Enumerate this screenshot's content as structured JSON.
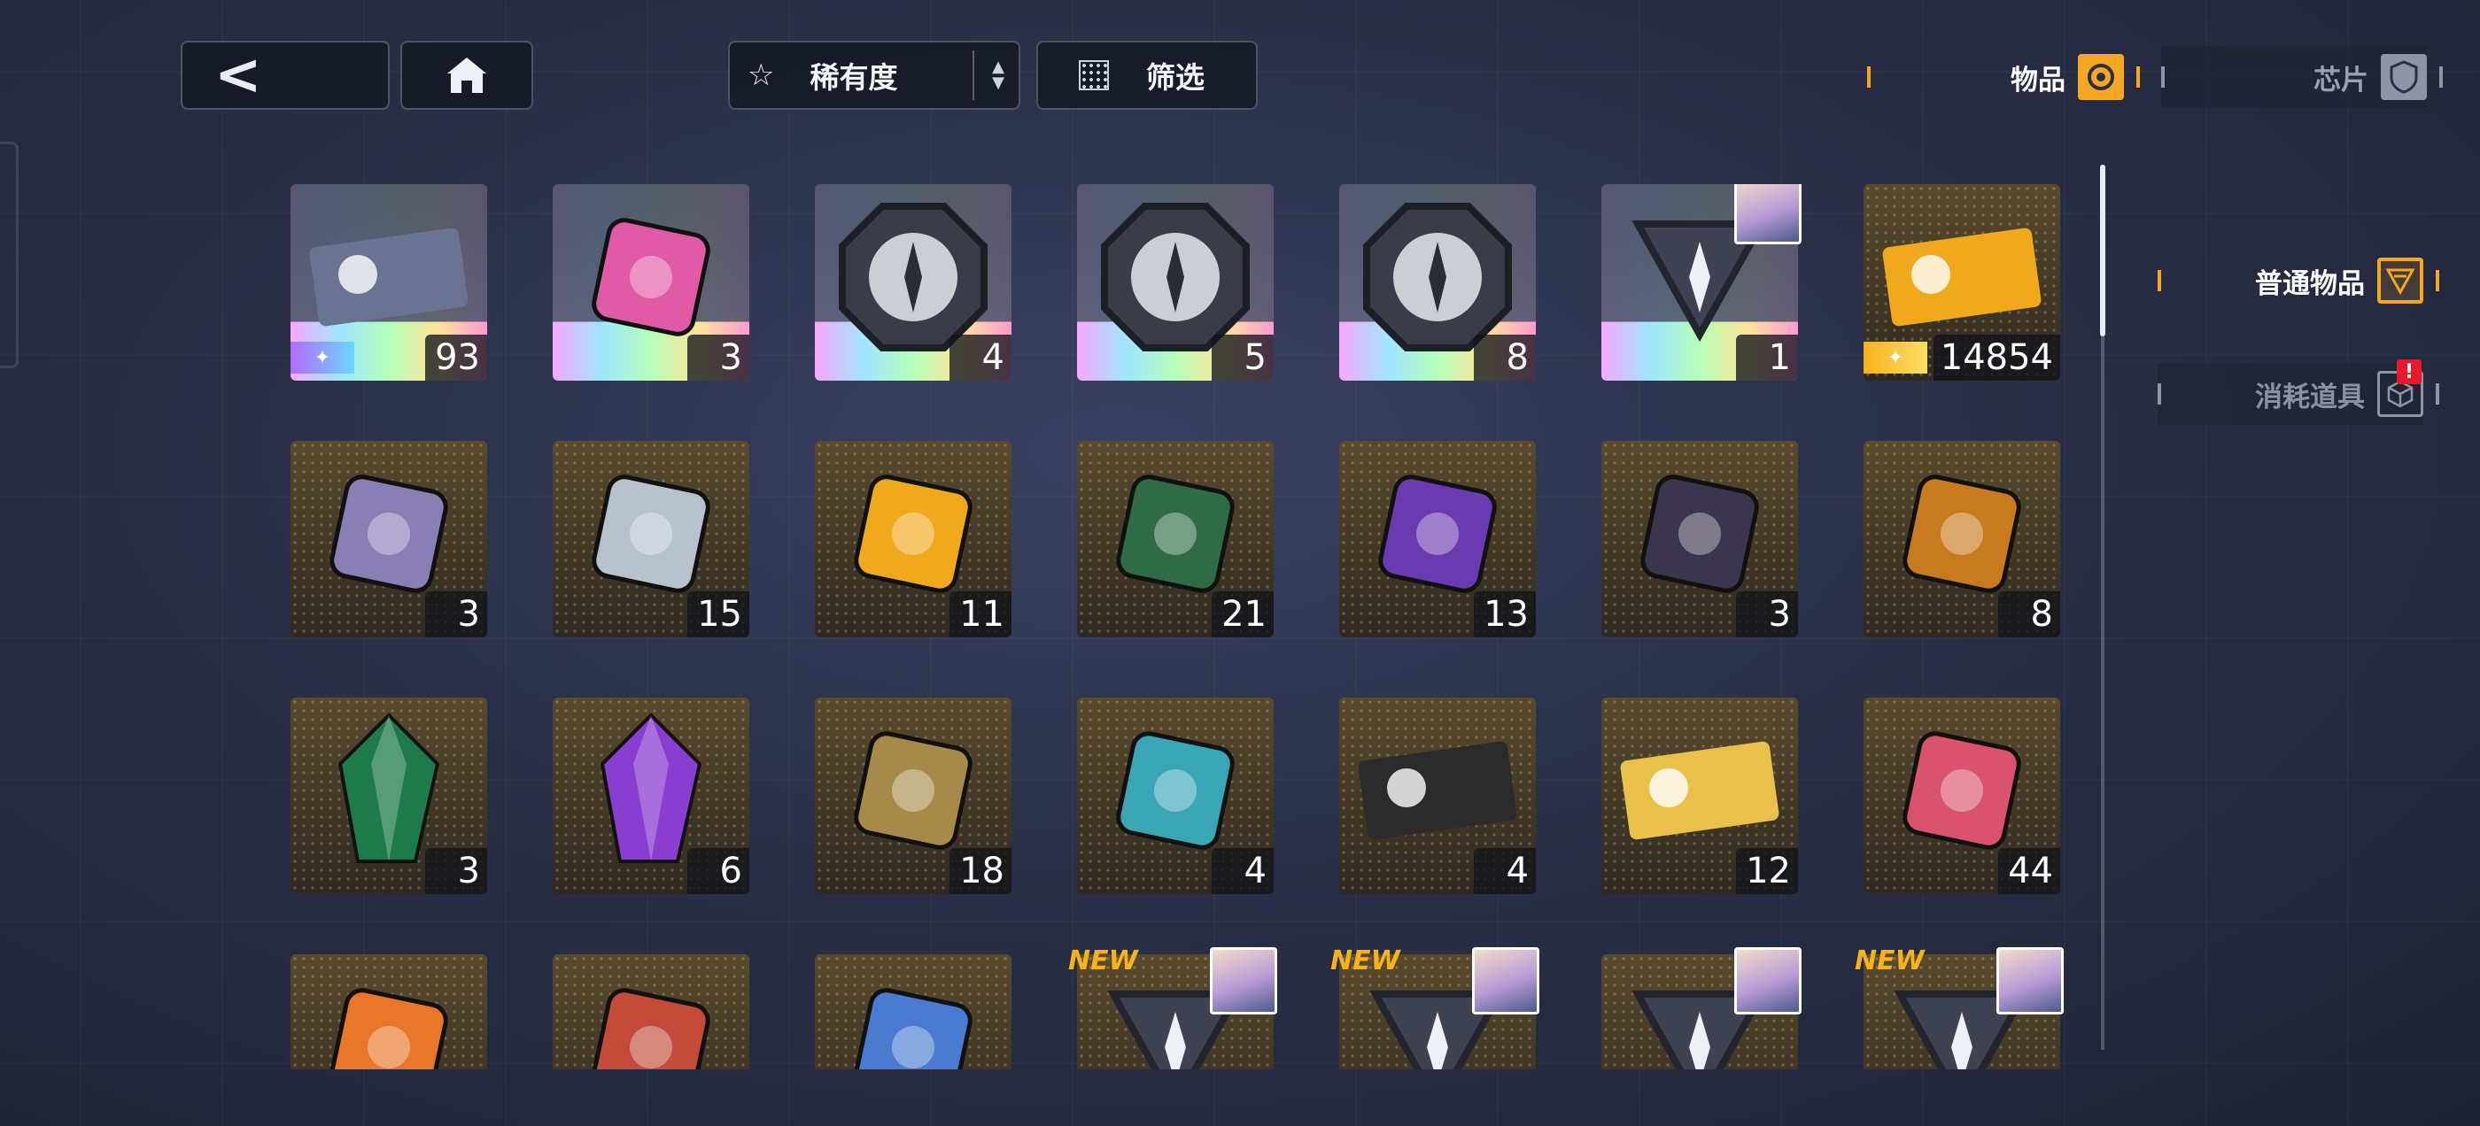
{
  "nav": {
    "back_glyph": "<"
  },
  "toolbar": {
    "sort_star": "☆",
    "sort_label": "稀有度",
    "sort_up": "▲",
    "sort_down": "▼",
    "filter_label": "筛选"
  },
  "tabs": [
    {
      "label": "物品",
      "icon": "item-icon",
      "active": true
    },
    {
      "label": "芯片",
      "icon": "chip-shield-icon",
      "active": false
    }
  ],
  "subtabs": [
    {
      "label": "普通物品",
      "icon": "box-icon",
      "active": true
    },
    {
      "label": "消耗道具",
      "icon": "cube-icon",
      "active": false,
      "badge": "!"
    }
  ],
  "colors": {
    "accent": "#f5a623",
    "badge": "#e8192c",
    "new_tag": "#f5b21b"
  },
  "items": [
    {
      "name": "nikke-ticket-card",
      "count": "93",
      "frame": "rainbow",
      "rarity_icon": "✦"
    },
    {
      "name": "heart-gift-box",
      "count": "3",
      "frame": "rainbow"
    },
    {
      "name": "octagon-emblem-wings",
      "count": "4",
      "frame": "rainbow"
    },
    {
      "name": "octagon-emblem-sword",
      "count": "5",
      "frame": "rainbow"
    },
    {
      "name": "octagon-emblem-gear",
      "count": "8",
      "frame": "rainbow"
    },
    {
      "name": "triangle-core-portrait",
      "count": "1",
      "frame": "rainbow",
      "portrait": true
    },
    {
      "name": "gold-nikke-ticket",
      "count": "14854",
      "frame": "gold",
      "rarity_icon": "✦"
    },
    {
      "name": "spiral-module-box",
      "count": "3",
      "frame": "gold"
    },
    {
      "name": "lock-triangle-chip",
      "count": "15",
      "frame": "gold"
    },
    {
      "name": "gold-cube-cluster",
      "count": "11",
      "frame": "gold"
    },
    {
      "name": "green-supply-bag",
      "count": "21",
      "frame": "gold"
    },
    {
      "name": "purple-orb-device",
      "count": "13",
      "frame": "gold"
    },
    {
      "name": "lantern-core",
      "count": "3",
      "frame": "gold"
    },
    {
      "name": "gold-brick-pile",
      "count": "8",
      "frame": "gold"
    },
    {
      "name": "green-crystal",
      "count": "3",
      "frame": "gold"
    },
    {
      "name": "purple-crystal",
      "count": "6",
      "frame": "gold"
    },
    {
      "name": "battery-capsule",
      "count": "18",
      "frame": "gold"
    },
    {
      "name": "cyan-drill-gear",
      "count": "4",
      "frame": "gold"
    },
    {
      "name": "black-data-card",
      "count": "4",
      "frame": "gold"
    },
    {
      "name": "gold-coupon-ticket",
      "count": "12",
      "frame": "gold"
    },
    {
      "name": "dango-plate",
      "count": "44",
      "frame": "gold"
    },
    {
      "name": "orange-gadget",
      "count": "",
      "frame": "gold"
    },
    {
      "name": "red-food-plate",
      "count": "",
      "frame": "gold"
    },
    {
      "name": "game-console-box",
      "count": "",
      "frame": "gold"
    },
    {
      "name": "core-emblem-new-1",
      "count": "",
      "frame": "gold",
      "new": "NEW",
      "portrait": true
    },
    {
      "name": "core-emblem-new-2",
      "count": "",
      "frame": "gold",
      "new": "NEW",
      "portrait": true
    },
    {
      "name": "core-emblem-3",
      "count": "",
      "frame": "gold",
      "portrait": true
    },
    {
      "name": "core-emblem-new-4",
      "count": "",
      "frame": "gold",
      "new": "NEW",
      "portrait": true
    }
  ]
}
